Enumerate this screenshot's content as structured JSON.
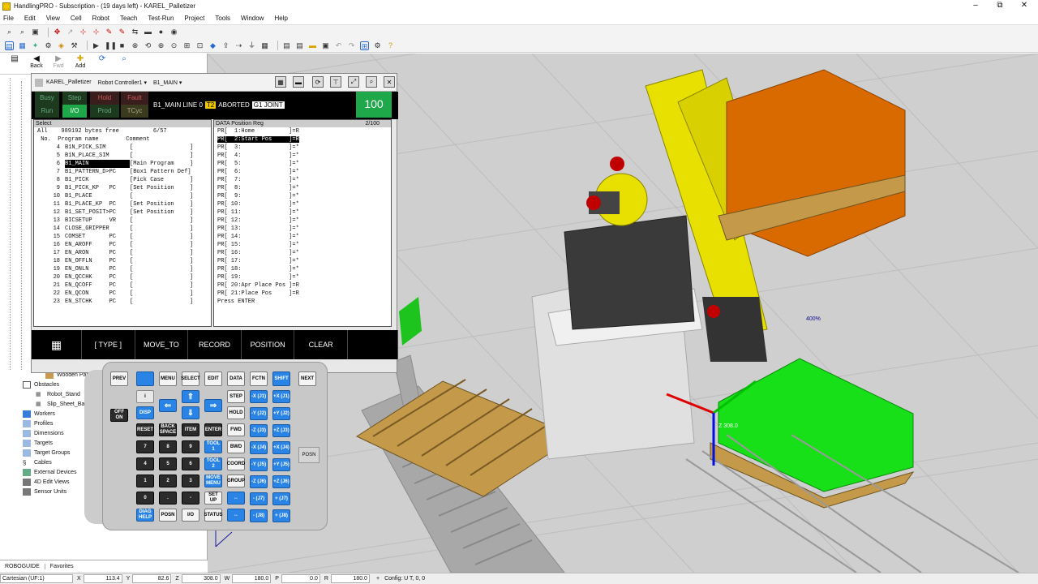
{
  "window": {
    "title": "HandlingPRO - Subscription - (19 days left) - KAREL_Palletizer",
    "controls": [
      "–",
      "⧉",
      "✕"
    ]
  },
  "menu": [
    "File",
    "Edit",
    "View",
    "Cell",
    "Robot",
    "Teach",
    "Test-Run",
    "Project",
    "Tools",
    "Window",
    "Help"
  ],
  "nav": {
    "back": "Back",
    "fwd": "Fwd",
    "add": "Add"
  },
  "tree": [
    {
      "label": "Wooden Pallet",
      "indent": 3
    },
    {
      "label": "Obstacles",
      "indent": 2
    },
    {
      "label": "Robot_Stand",
      "indent": 3
    },
    {
      "label": "Slip_Sheet_Bas",
      "indent": 3
    },
    {
      "label": "Workers",
      "indent": 2
    },
    {
      "label": "Profiles",
      "indent": 2
    },
    {
      "label": "Dimensions",
      "indent": 2
    },
    {
      "label": "Targets",
      "indent": 2
    },
    {
      "label": "Target Groups",
      "indent": 2
    },
    {
      "label": "Cables",
      "indent": 2
    },
    {
      "label": "External Devices",
      "indent": 2
    },
    {
      "label": "4D Edit Views",
      "indent": 2
    },
    {
      "label": "Sensor Units",
      "indent": 2
    }
  ],
  "bottom_tabs": [
    "ROBOGUIDE",
    "Favorites"
  ],
  "status": {
    "frame": "Cartesian (UF:1)",
    "x_label": "X",
    "x": "113.4",
    "y_label": "Y",
    "y": "82.6",
    "z_label": "Z",
    "z": "308.0",
    "w_label": "W",
    "w": "180.0",
    "p_label": "P",
    "p": "0.0",
    "r_label": "R",
    "r": "180.0",
    "config": "Config: U T, 0, 0"
  },
  "pendant": {
    "header": {
      "cell": "KAREL_Palletizer",
      "controller": "Robot Controller1 ▾",
      "program": "B1_MAIN ▾"
    },
    "leds": [
      "Busy",
      "Step",
      "Hold",
      "Fault",
      "Run",
      "I/O",
      "Prod",
      "TCyc"
    ],
    "status": {
      "prog": "B1_MAIN LINE 0",
      "mode": "T2",
      "state": "ABORTED",
      "joint": "G1 JOINT"
    },
    "override": "100",
    "select": {
      "title": "Select",
      "summary": "All    989192 bytes free          6/57",
      "header": " No.  Program name        Comment",
      "rows": [
        [
          "4",
          "B1N_PICK_SIM",
          "[",
          "]"
        ],
        [
          "5",
          "B1N_PLACE_SIM",
          "[",
          "]"
        ],
        [
          "6",
          "B1_MAIN",
          "[Main Program",
          "]"
        ],
        [
          "7",
          "B1_PATTERN_D>PC",
          "[Box1 Pattern Def]",
          ""
        ],
        [
          "8",
          "B1_PICK",
          "[Pick Case",
          "]"
        ],
        [
          "9",
          "B1_PICK_KP   PC",
          "[Set Position",
          "]"
        ],
        [
          "10",
          "B1_PLACE",
          "[",
          "]"
        ],
        [
          "11",
          "B1_PLACE_KP  PC",
          "[Set Position",
          "]"
        ],
        [
          "12",
          "B1_SET_POSIT>PC",
          "[Set Position",
          "]"
        ],
        [
          "13",
          "BICSETUP     VR",
          "[",
          "]"
        ],
        [
          "14",
          "CLOSE_GRIPPER",
          "[",
          "]"
        ],
        [
          "15",
          "COMSET       PC",
          "[",
          "]"
        ],
        [
          "16",
          "EN_AROFF     PC",
          "[",
          "]"
        ],
        [
          "17",
          "EN_ARON      PC",
          "[",
          "]"
        ],
        [
          "18",
          "EN_OFFLN     PC",
          "[",
          "]"
        ],
        [
          "19",
          "EN_ONLN      PC",
          "[",
          "]"
        ],
        [
          "20",
          "EN_QCCHK     PC",
          "[",
          "]"
        ],
        [
          "21",
          "EN_QCOFF     PC",
          "[",
          "]"
        ],
        [
          "22",
          "EN_QCON      PC",
          "[",
          "]"
        ],
        [
          "23",
          "EN_STCHK     PC",
          "[",
          "]"
        ]
      ]
    },
    "data": {
      "title": "DATA Position Reg",
      "page": "2/100",
      "rows": [
        "PR[  1:Home          ]=R",
        "PR[  2:Start Pos     ]=R",
        "PR[  3:              ]=*",
        "PR[  4:              ]=*",
        "PR[  5:              ]=*",
        "PR[  6:              ]=*",
        "PR[  7:              ]=*",
        "PR[  8:              ]=*",
        "PR[  9:              ]=*",
        "PR[ 10:              ]=*",
        "PR[ 11:              ]=*",
        "PR[ 12:              ]=*",
        "PR[ 13:              ]=*",
        "PR[ 14:              ]=*",
        "PR[ 15:              ]=*",
        "PR[ 16:              ]=*",
        "PR[ 17:              ]=*",
        "PR[ 18:              ]=*",
        "PR[ 19:              ]=*",
        "PR[ 20:Apr Place Pos ]=R",
        "PR[ 21:Place Pos     ]=R",
        "Press ENTER"
      ]
    },
    "fkeys": [
      "[ TYPE ]",
      "MOVE_TO",
      "RECORD",
      "POSITION",
      "CLEAR"
    ]
  },
  "keypad": {
    "top": [
      "PREV",
      "",
      "MENU",
      "SELECT",
      "EDIT",
      "DATA",
      "FCTN",
      "SHIFT",
      "NEXT"
    ],
    "nums": [
      "7",
      "8",
      "9",
      "4",
      "5",
      "6",
      "1",
      "2",
      "3",
      "0",
      ".",
      "-"
    ],
    "misc": [
      "i",
      "DISP",
      "RESET",
      "BACK SPACE",
      "ITEM",
      "ENTER",
      "SET UP",
      "DIAG HELP",
      "POSN",
      "I/O",
      "STATUS",
      "STEP",
      "HOLD",
      "FWD",
      "BWD",
      "COORD",
      "GROUP",
      "TOOL 1",
      "TOOL 2",
      "MOVE MENU",
      "OFF ON"
    ],
    "jog": [
      "-X (J1)",
      "+X (J1)",
      "-Y (J2)",
      "+Y (J2)",
      "-Z (J3)",
      "+Z (J3)",
      "-X (J4)",
      "+X (J4)",
      "-Y (J5)",
      "+Y (J5)",
      "-Z (J6)",
      "+Z (J6)",
      "- (J7)",
      "+ (J7)",
      "- (J8)",
      "+ (J8)"
    ],
    "posn_side": "POSN"
  },
  "viewport_labels": {
    "tcp_z": "Z 308.0",
    "box_label": "400%"
  },
  "colors": {
    "pendant_green": "#1fa84a",
    "key_blue": "#2a84e6",
    "robot_yellow": "#e8e000",
    "box_orange": "#d86a00",
    "box_green": "#18e018"
  }
}
